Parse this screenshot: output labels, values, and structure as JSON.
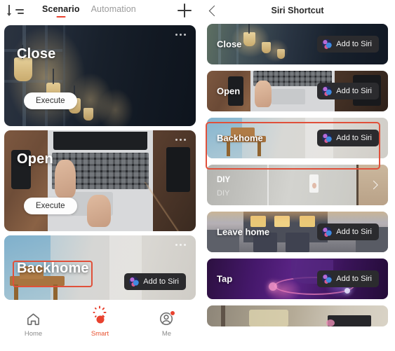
{
  "left_screen": {
    "header": {
      "sort_icon": "sort-list-icon",
      "tabs": [
        {
          "label": "Scenario",
          "active": true
        },
        {
          "label": "Automation",
          "active": false
        }
      ],
      "add_icon": "plus-icon",
      "active_indicator_color": "#e8422f"
    },
    "scenarios": [
      {
        "title": "Close",
        "action_label": "Execute",
        "menu_icon": "more-dots-icon",
        "scene": "dark-pendant-lamps"
      },
      {
        "title": "Open",
        "action_label": "Execute",
        "menu_icon": "more-dots-icon",
        "scene": "laptop-typing-overhead"
      },
      {
        "title": "Backhome",
        "siri_label": "Add to Siri",
        "menu_icon": "more-dots-icon",
        "scene": "bright-room-chair",
        "highlighted": true
      }
    ],
    "bottom_nav": [
      {
        "label": "Home",
        "icon": "home-icon",
        "active": false
      },
      {
        "label": "Smart",
        "icon": "sun-burst-icon",
        "active": true
      },
      {
        "label": "Me",
        "icon": "account-icon",
        "active": false,
        "badge": true
      }
    ]
  },
  "right_screen": {
    "header": {
      "back_icon": "back-chevron-icon",
      "title": "Siri Shortcut"
    },
    "rows": [
      {
        "title": "Close",
        "siri_label": "Add to Siri",
        "scene": "dark-pendant-lamps"
      },
      {
        "title": "Open",
        "siri_label": "Add to Siri",
        "scene": "laptop-typing-overhead"
      },
      {
        "title": "Backhome",
        "siri_label": "Add to Siri",
        "scene": "bright-room-chair",
        "highlighted": true
      },
      {
        "title": "DIY",
        "subtitle": "DIY",
        "chevron_icon": "chevron-right-icon",
        "scene": "pale-interior"
      },
      {
        "title": "Leave home",
        "siri_label": "Add to Siri",
        "scene": "house-at-dusk"
      },
      {
        "title": "Tap",
        "siri_label": "Add to Siri",
        "scene": "purple-neon"
      },
      {
        "title": "",
        "siri_label": "",
        "scene": "partial-room"
      }
    ]
  },
  "colors": {
    "accent": "#e8422f",
    "highlight_box": "#e0503a",
    "siri_button_bg": "#2b2b2e",
    "background": "#ffffff"
  }
}
